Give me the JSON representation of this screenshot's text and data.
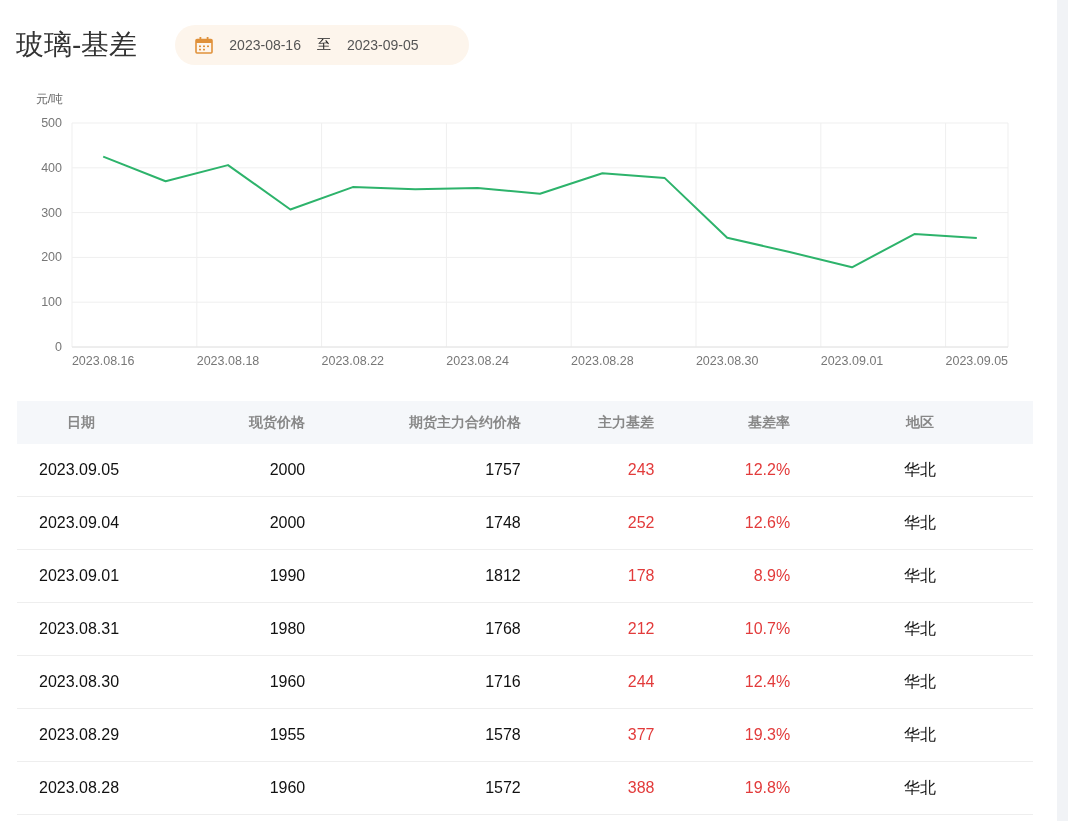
{
  "title": "玻璃-基差",
  "date_range": {
    "start": "2023-08-16",
    "separator": "至",
    "end": "2023-09-05"
  },
  "chart": {
    "chart_data": {
      "type": "line",
      "ylabel": "元/吨",
      "categories": [
        "2023.08.16",
        null,
        "2023.08.18",
        null,
        "2023.08.22",
        null,
        "2023.08.24",
        null,
        "2023.08.28",
        null,
        "2023.08.30",
        null,
        "2023.09.01",
        null,
        "2023.09.05"
      ],
      "grid": true,
      "series": [
        {
          "color": "#2db36b",
          "values": [
            425,
            370,
            406,
            307,
            357,
            352,
            355,
            342,
            388,
            377,
            244,
            212,
            178,
            252,
            243
          ]
        }
      ],
      "ylim": [
        0,
        500
      ],
      "yticks": [
        0,
        100,
        200,
        300,
        400,
        500
      ]
    }
  },
  "table": {
    "columns": [
      {
        "label": "日期"
      },
      {
        "label": "现货价格"
      },
      {
        "label": "期货主力合约价格"
      },
      {
        "label": "主力基差"
      },
      {
        "label": "基差率"
      },
      {
        "label": "地区"
      }
    ],
    "rows": [
      [
        "2023.09.05",
        "2000",
        "1757",
        "243",
        "12.2%",
        "华北"
      ],
      [
        "2023.09.04",
        "2000",
        "1748",
        "252",
        "12.6%",
        "华北"
      ],
      [
        "2023.09.01",
        "1990",
        "1812",
        "178",
        "8.9%",
        "华北"
      ],
      [
        "2023.08.31",
        "1980",
        "1768",
        "212",
        "10.7%",
        "华北"
      ],
      [
        "2023.08.30",
        "1960",
        "1716",
        "244",
        "12.4%",
        "华北"
      ],
      [
        "2023.08.29",
        "1955",
        "1578",
        "377",
        "19.3%",
        "华北"
      ],
      [
        "2023.08.28",
        "1960",
        "1572",
        "388",
        "19.8%",
        "华北"
      ]
    ]
  }
}
